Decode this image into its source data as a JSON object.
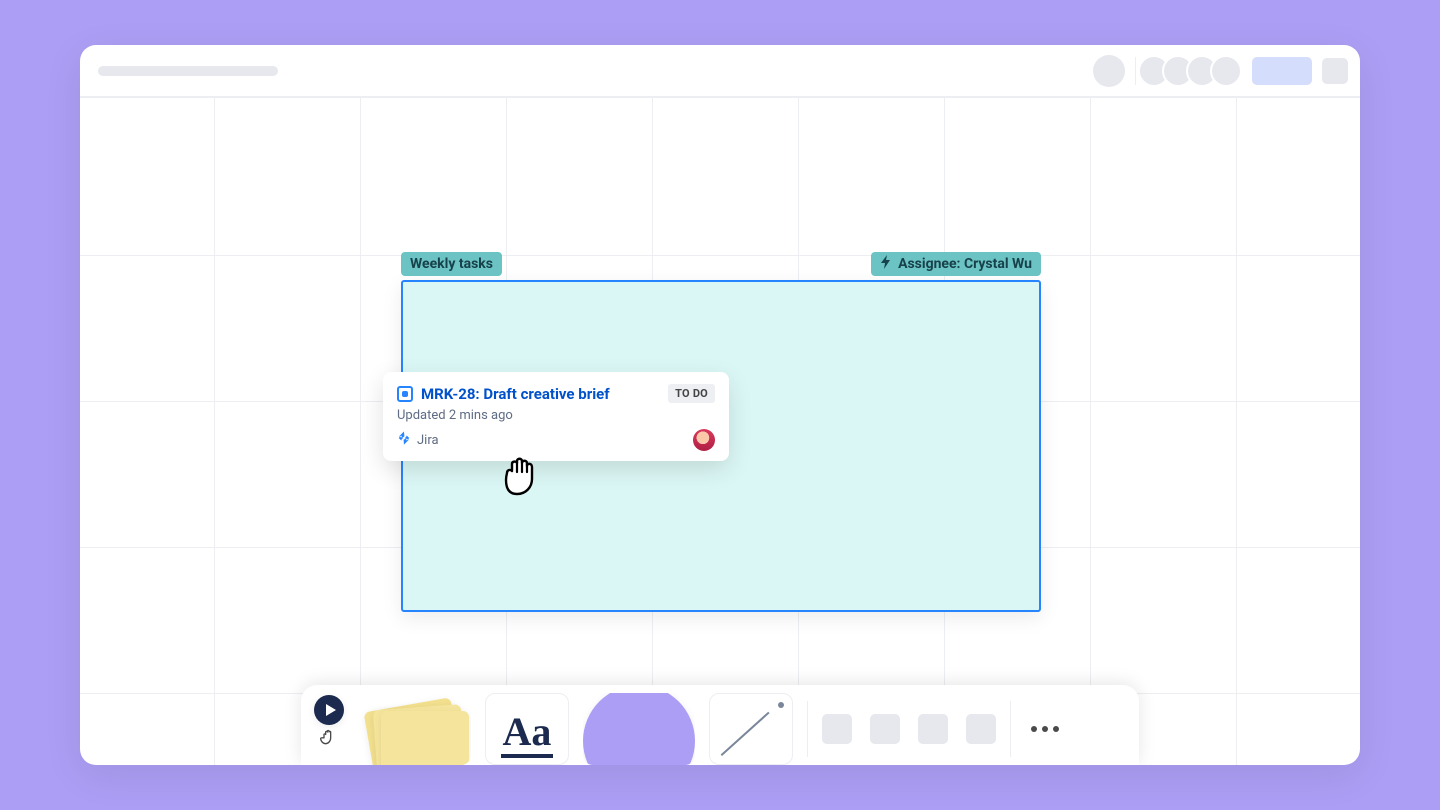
{
  "section": {
    "title_label": "Weekly tasks",
    "smart_label": "Assignee: Crystal Wu"
  },
  "card": {
    "title": "MRK-28: Draft creative brief",
    "status": "TO DO",
    "subtitle": "Updated 2 mins ago",
    "app_name": "Jira"
  },
  "toolbar": {
    "text_tool_glyph": "Aa"
  }
}
